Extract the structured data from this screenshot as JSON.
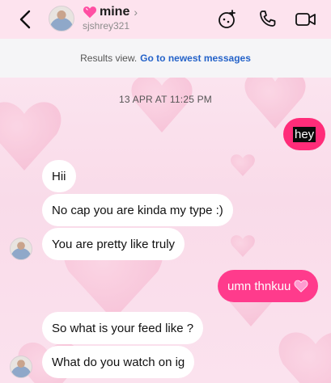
{
  "header": {
    "name_emoji": "heart-emoji",
    "name": "mine",
    "handle": "sjshrey321",
    "icons": [
      "back-arrow-icon",
      "effects-icon",
      "phone-icon",
      "video-icon"
    ]
  },
  "results_bar": {
    "text": "Results view.",
    "link": "Go to newest messages"
  },
  "timestamp": "13 APR AT 11:25 PM",
  "messages": [
    {
      "side": "out",
      "text": "hey"
    },
    {
      "side": "in",
      "text": "Hii"
    },
    {
      "side": "in",
      "text": "No cap you are kinda my type :)"
    },
    {
      "side": "in",
      "text": "You are pretty like truly"
    },
    {
      "side": "out",
      "text": "umn thnkuu"
    },
    {
      "side": "in",
      "text": "So what is your feed like ?"
    },
    {
      "side": "in",
      "text": "What do you watch on ig"
    }
  ],
  "colors": {
    "outgoing_bubble": "#ff3b8c",
    "incoming_bubble": "#ffffff",
    "link": "#2563c9",
    "background": "#fbe3ee"
  }
}
